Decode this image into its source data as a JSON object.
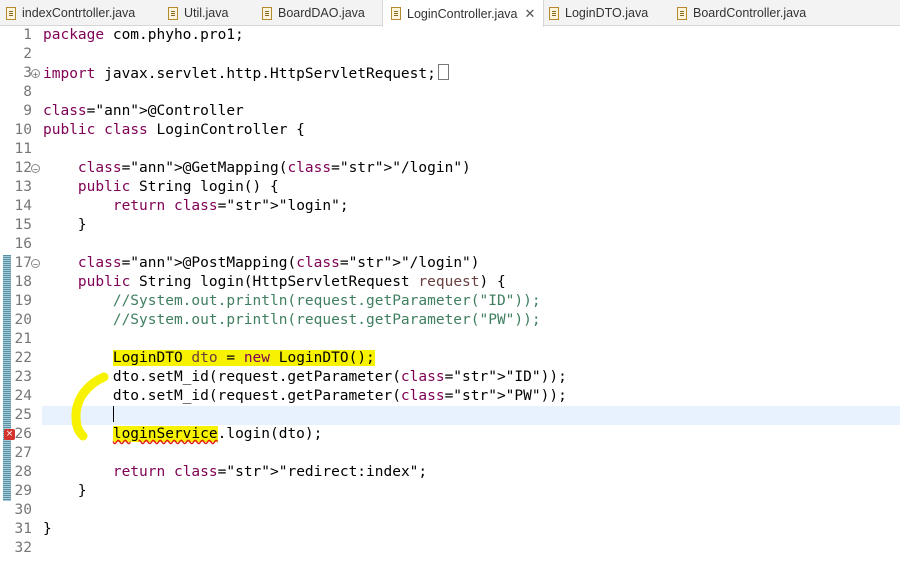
{
  "tabs": [
    {
      "label": "indexContrtoller.java",
      "active": false
    },
    {
      "label": "Util.java",
      "active": false
    },
    {
      "label": "BoardDAO.java",
      "active": false
    },
    {
      "label": "LoginController.java",
      "active": true
    },
    {
      "label": "LoginDTO.java",
      "active": false
    },
    {
      "label": "BoardController.java",
      "active": false
    }
  ],
  "tab_close_symbol": "✕",
  "editor": {
    "current_line": 25,
    "error_line": 26,
    "lines": [
      {
        "n": "1",
        "text": "package com.phyho.pro1;"
      },
      {
        "n": "2",
        "text": ""
      },
      {
        "n": "3",
        "text": "import javax.servlet.http.HttpServletRequest;"
      },
      {
        "n": "8",
        "text": ""
      },
      {
        "n": "9",
        "text": "@Controller"
      },
      {
        "n": "10",
        "text": "public class LoginController {"
      },
      {
        "n": "11",
        "text": ""
      },
      {
        "n": "12",
        "text": "    @GetMapping(\"/login\")"
      },
      {
        "n": "13",
        "text": "    public String login() {"
      },
      {
        "n": "14",
        "text": "        return \"login\";"
      },
      {
        "n": "15",
        "text": "    }"
      },
      {
        "n": "16",
        "text": ""
      },
      {
        "n": "17",
        "text": "    @PostMapping(\"/login\")"
      },
      {
        "n": "18",
        "text": "    public String login(HttpServletRequest request) {"
      },
      {
        "n": "19",
        "text": "        //System.out.println(request.getParameter(\"ID\"));"
      },
      {
        "n": "20",
        "text": "        //System.out.println(request.getParameter(\"PW\"));"
      },
      {
        "n": "21",
        "text": ""
      },
      {
        "n": "22",
        "text": "        LoginDTO dto = new LoginDTO();"
      },
      {
        "n": "23",
        "text": "        dto.setM_id(request.getParameter(\"ID\"));"
      },
      {
        "n": "24",
        "text": "        dto.setM_id(request.getParameter(\"PW\"));"
      },
      {
        "n": "25",
        "text": ""
      },
      {
        "n": "26",
        "text": "        loginService.login(dto);"
      },
      {
        "n": "27",
        "text": ""
      },
      {
        "n": "28",
        "text": "        return \"redirect:index\";"
      },
      {
        "n": "29",
        "text": "    }"
      },
      {
        "n": "30",
        "text": ""
      },
      {
        "n": "31",
        "text": "}"
      },
      {
        "n": "32",
        "text": ""
      }
    ]
  },
  "colors": {
    "keyword": "#7f0055",
    "string": "#2a00ff",
    "comment": "#3f7f5f",
    "annotation": "#646464",
    "highlighter": "#f7f200",
    "current_line": "#e8f2fe"
  }
}
